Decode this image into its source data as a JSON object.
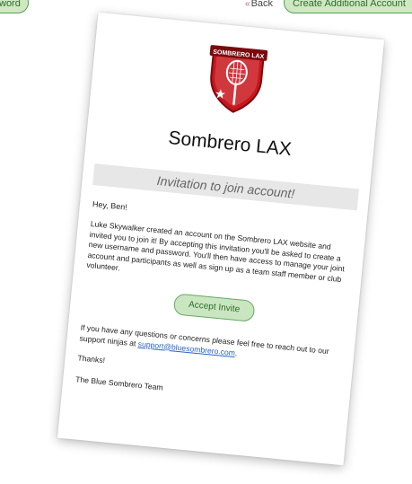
{
  "toolbar": {
    "left_button_label": "word",
    "back_label": "Back",
    "back_chevron": "«",
    "create_button_label": "Create Additional Account"
  },
  "email": {
    "logo": {
      "text": "SOMBRERO LAX",
      "colors": {
        "shield_red": "#c8161d",
        "banner_dark": "#7a0a0e",
        "accent_white": "#ffffff"
      }
    },
    "org_name": "Sombrero LAX",
    "banner_title": "Invitation to join account!",
    "greeting": "Hey, Ben!",
    "body_paragraph": "Luke Skywalker created an account on the Sombrero LAX website and invited you to join it! By accepting this invitation you'll be asked to create a new username and password. You'll then have access to manage your joint account and participants as well as sign up as a team staff member or club volunteer.",
    "accept_button_label": "Accept Invite",
    "contact_prefix": "If you have any questions or concerns please feel free to reach out to our support ninjas at ",
    "support_email": "support@bluesombrero.com",
    "contact_suffix": ".",
    "thanks": "Thanks!",
    "signature": "The Blue Sombrero Team"
  },
  "colors": {
    "button_fill": "#cfe8c2",
    "button_border": "#55a255",
    "link": "#2a63c5",
    "banner_bg": "#e7e7e7"
  }
}
